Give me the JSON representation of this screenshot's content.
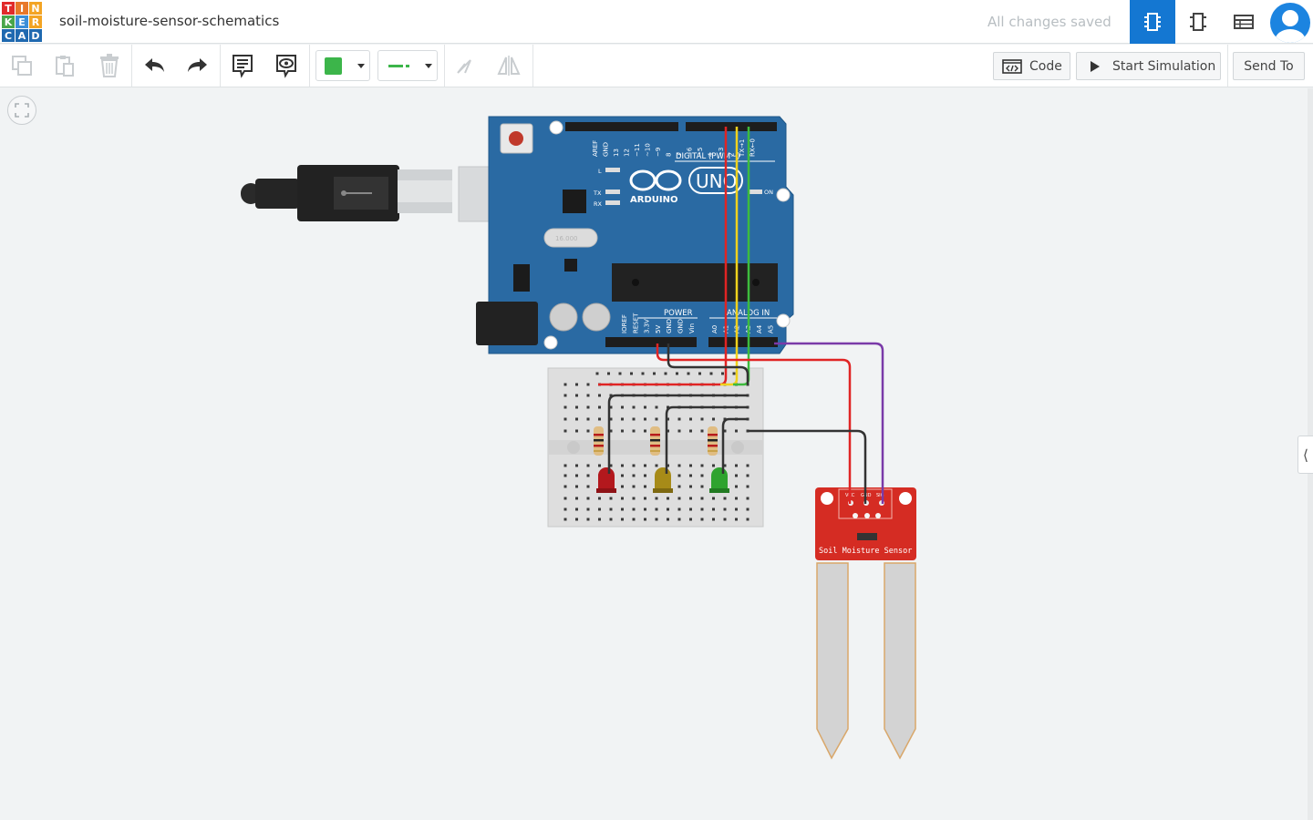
{
  "app": {
    "logo_letters": [
      "T",
      "I",
      "N",
      "K",
      "E",
      "R",
      "C",
      "A",
      "D"
    ],
    "logo_colors": [
      "#e12b2b",
      "#e8782a",
      "#f3a424",
      "#8c4fb5",
      "#3c8fd8",
      "#3c8fd8",
      "#1f69b0",
      "#1f69b0",
      "#1f69b0"
    ],
    "project_title": "soil-moisture-sensor-schematics",
    "save_status": "All changes saved",
    "accent_color": "#1477d2"
  },
  "view_switcher": {
    "active": "circuit-view",
    "buttons": [
      "circuit-view-icon",
      "schematic-view-icon",
      "component-list-icon"
    ]
  },
  "toolbar": {
    "left_tools": [
      "copy-icon",
      "paste-icon",
      "delete-icon",
      "undo-icon",
      "redo-icon",
      "notes-icon",
      "toggle-notes-icon",
      "rotate-icon",
      "flip-icon"
    ],
    "wire_color": "#3cb54a",
    "code_label": "Code",
    "simulate_label": "Start Simulation",
    "send_label": "Send To"
  },
  "canvas": {
    "arduino": {
      "brand": "ARDUINO",
      "model": "UNO",
      "digital_label": "DIGITAL (PWM~)",
      "power_label": "POWER",
      "analog_label": "ANALOG IN",
      "on_label": "ON",
      "l_label": "L",
      "tx_label": "TX",
      "rx_label": "RX",
      "crystal_label": "16.000",
      "digital_pins": [
        "AREF",
        "GND",
        "13",
        "12",
        "~11",
        "~10",
        "~9",
        "8",
        "7",
        "~6",
        "~5",
        "4",
        "~3",
        "2",
        "TX→1",
        "RX←0"
      ],
      "power_pins": [
        "IOREF",
        "RESET",
        "3.3V",
        "5V",
        "GND",
        "GND",
        "Vin"
      ],
      "analog_pins": [
        "A0",
        "A1",
        "A2",
        "A3",
        "A4",
        "A5"
      ]
    },
    "sensor": {
      "label": "Soil Moisture Sensor",
      "pins": [
        "VCC",
        "GND",
        "SIG"
      ]
    },
    "leds": [
      {
        "color": "red",
        "hex": "#b3181d"
      },
      {
        "color": "yellow",
        "hex": "#a78b18"
      },
      {
        "color": "green",
        "hex": "#2fa32f"
      }
    ],
    "wires": [
      {
        "name": "red-wire",
        "hex": "#e02424"
      },
      {
        "name": "yellow-wire",
        "hex": "#f0d21c"
      },
      {
        "name": "green-wire",
        "hex": "#3dbb3d"
      },
      {
        "name": "black-wire",
        "hex": "#333333"
      },
      {
        "name": "purple-wire",
        "hex": "#7a3aa8"
      }
    ]
  }
}
